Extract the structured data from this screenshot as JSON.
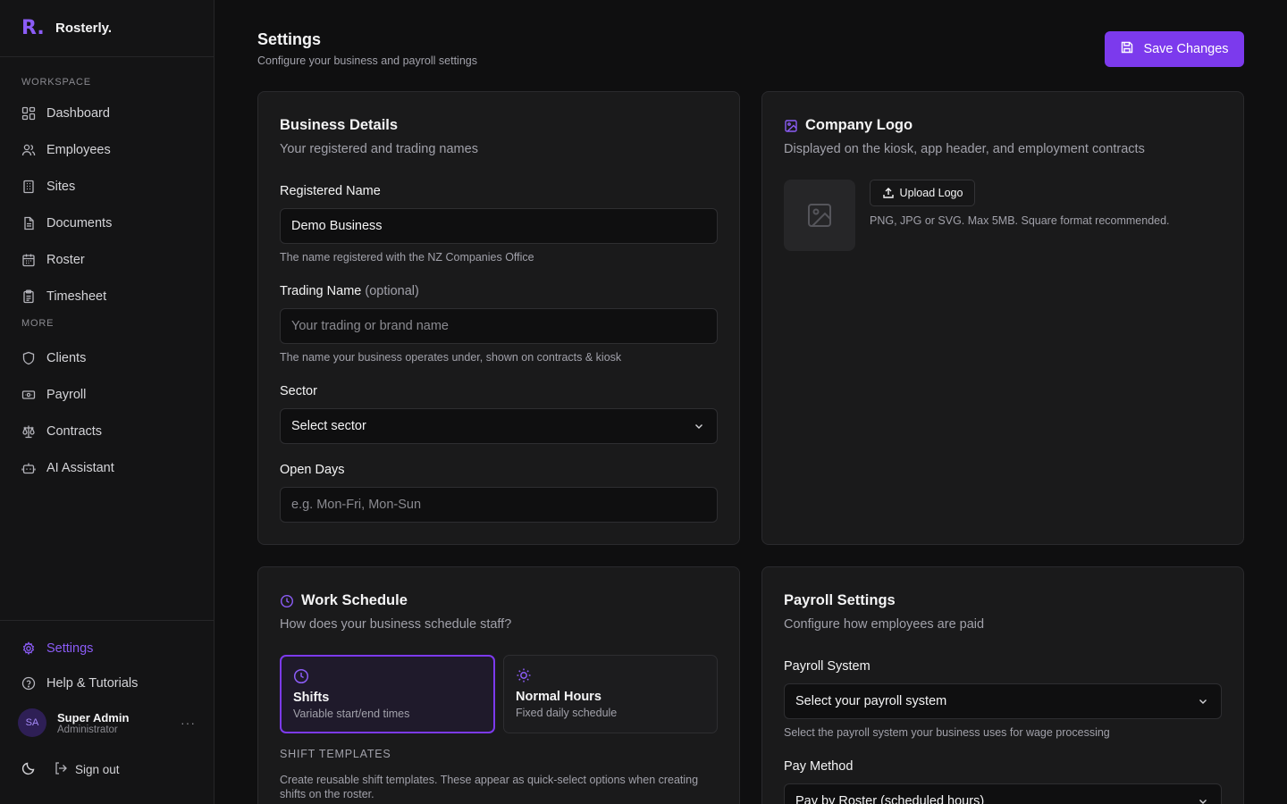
{
  "brand": {
    "logo": "R.",
    "name": "Rosterly."
  },
  "sidebar": {
    "workspace_label": "WORKSPACE",
    "more_label": "MORE",
    "workspace_items": [
      {
        "label": "Dashboard",
        "icon": "dashboard-icon"
      },
      {
        "label": "Employees",
        "icon": "users-icon"
      },
      {
        "label": "Sites",
        "icon": "building-icon"
      },
      {
        "label": "Documents",
        "icon": "document-icon"
      },
      {
        "label": "Roster",
        "icon": "calendar-icon"
      },
      {
        "label": "Timesheet",
        "icon": "clipboard-icon"
      }
    ],
    "more_items": [
      {
        "label": "Clients",
        "icon": "shield-icon"
      },
      {
        "label": "Payroll",
        "icon": "banknote-icon"
      },
      {
        "label": "Contracts",
        "icon": "scale-icon"
      },
      {
        "label": "AI Assistant",
        "icon": "bot-icon"
      }
    ],
    "settings_label": "Settings",
    "help_label": "Help & Tutorials",
    "user": {
      "initials": "SA",
      "name": "Super Admin",
      "role": "Administrator"
    },
    "more_dots": "···",
    "sign_out_label": "Sign out"
  },
  "header": {
    "title": "Settings",
    "subtitle": "Configure your business and payroll settings",
    "save_label": "Save Changes"
  },
  "business": {
    "title": "Business Details",
    "subtitle": "Your registered and trading names",
    "registered_label": "Registered Name",
    "registered_value": "Demo Business",
    "registered_help": "The name registered with the NZ Companies Office",
    "trading_label": "Trading Name",
    "trading_optional": "(optional)",
    "trading_placeholder": "Your trading or brand name",
    "trading_help": "The name your business operates under, shown on contracts & kiosk",
    "sector_label": "Sector",
    "sector_value": "Select sector",
    "open_days_label": "Open Days",
    "open_days_placeholder": "e.g. Mon-Fri, Mon-Sun"
  },
  "logo": {
    "title": "Company Logo",
    "subtitle": "Displayed on the kiosk, app header, and employment contracts",
    "upload_label": "Upload Logo",
    "help": "PNG, JPG or SVG. Max 5MB. Square format recommended."
  },
  "schedule": {
    "title": "Work Schedule",
    "subtitle": "How does your business schedule staff?",
    "options": [
      {
        "title": "Shifts",
        "sub": "Variable start/end times"
      },
      {
        "title": "Normal Hours",
        "sub": "Fixed daily schedule"
      }
    ],
    "templates_label": "SHIFT TEMPLATES",
    "templates_text": "Create reusable shift templates. These appear as quick-select options when creating shifts on the roster."
  },
  "payroll": {
    "title": "Payroll Settings",
    "subtitle": "Configure how employees are paid",
    "system_label": "Payroll System",
    "system_value": "Select your payroll system",
    "system_help": "Select the payroll system your business uses for wage processing",
    "method_label": "Pay Method",
    "method_value": "Pay by Roster (scheduled hours)"
  },
  "colors": {
    "accent": "#7c3aed",
    "accent_text": "#8b5cf6",
    "background": "#0f0f10",
    "card": "#1a1a1b"
  }
}
